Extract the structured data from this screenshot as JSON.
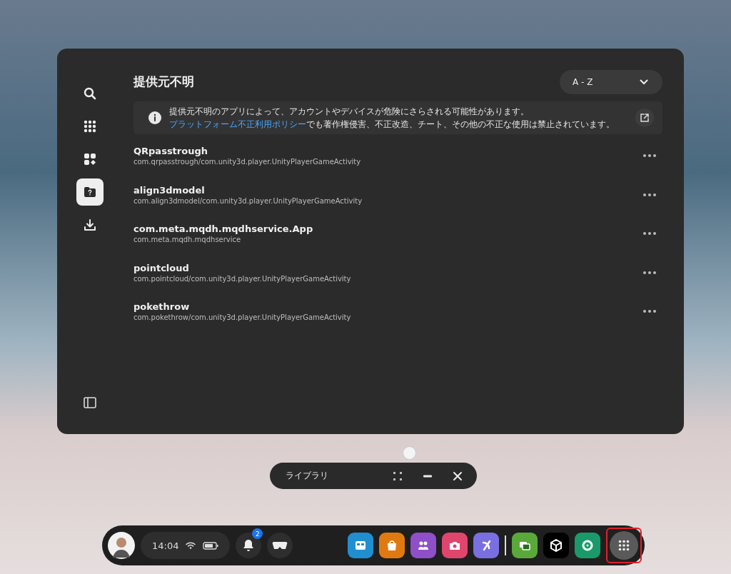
{
  "panel": {
    "title": "提供元不明",
    "sort": {
      "label": "A - Z"
    },
    "notice": {
      "text": "提供元不明のアプリによって、アカウントやデバイスが危険にさらされる可能性があります。",
      "link": "プラットフォーム不正利用ポリシー",
      "text_after": "でも著作権侵害、不正改造、チート、その他の不正な使用は禁止されています。"
    },
    "sidebar": [
      {
        "kind": "search",
        "selected": false
      },
      {
        "kind": "grid",
        "selected": false
      },
      {
        "kind": "tiles",
        "selected": false
      },
      {
        "kind": "unknown",
        "selected": true
      },
      {
        "kind": "download",
        "selected": false
      }
    ],
    "apps": [
      {
        "name": "QRpasstrough",
        "package": "com.qrpasstrough/com.unity3d.player.UnityPlayerGameActivity"
      },
      {
        "name": "align3dmodel",
        "package": "com.align3dmodel/com.unity3d.player.UnityPlayerGameActivity"
      },
      {
        "name": "com.meta.mqdh.mqdhservice.App",
        "package": "com.meta.mqdh.mqdhservice"
      },
      {
        "name": "pointcloud",
        "package": "com.pointcloud/com.unity3d.player.UnityPlayerGameActivity"
      },
      {
        "name": "pokethrow",
        "package": "com.pokethrow/com.unity3d.player.UnityPlayerGameActivity"
      }
    ]
  },
  "window_bar": {
    "title": "ライブラリ"
  },
  "dock": {
    "time": "14:04",
    "notifications": "2",
    "apps": [
      {
        "kind": "browser",
        "color": "#1f8fd0"
      },
      {
        "kind": "store",
        "color": "#e07a10"
      },
      {
        "kind": "people",
        "color": "#8e4fc8"
      },
      {
        "kind": "camera",
        "color": "#e0456e"
      },
      {
        "kind": "explore",
        "color": "#7a6fe0"
      },
      {
        "kind": "divider",
        "color": "#dddddd"
      },
      {
        "kind": "gallery",
        "color": "#5aa83a"
      },
      {
        "kind": "unity",
        "color": "#000000"
      },
      {
        "kind": "settings",
        "color": "#1a9a6a"
      }
    ],
    "launcher": {
      "highlighted": true
    }
  }
}
